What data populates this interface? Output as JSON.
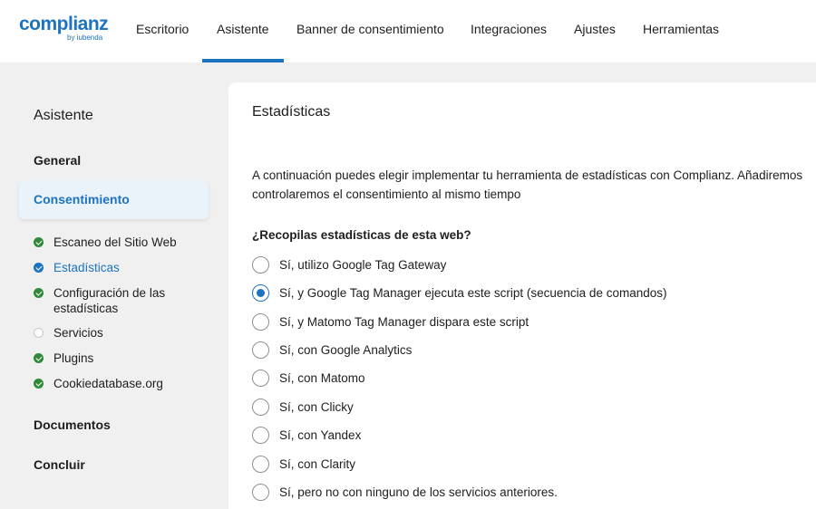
{
  "logo": {
    "name": "complianz",
    "sub": "by iubenda"
  },
  "nav": [
    {
      "label": "Escritorio",
      "active": false
    },
    {
      "label": "Asistente",
      "active": true
    },
    {
      "label": "Banner de consentimiento",
      "active": false
    },
    {
      "label": "Integraciones",
      "active": false
    },
    {
      "label": "Ajustes",
      "active": false
    },
    {
      "label": "Herramientas",
      "active": false
    }
  ],
  "sidebar": {
    "title": "Asistente",
    "sections": {
      "general": "General",
      "consent": "Consentimiento",
      "documents": "Documentos",
      "finish": "Concluir"
    },
    "steps": [
      {
        "label": "Escaneo del Sitio Web",
        "status": "done"
      },
      {
        "label": "Estadísticas",
        "status": "current"
      },
      {
        "label": "Configuración de las estadísticas",
        "status": "done"
      },
      {
        "label": "Servicios",
        "status": "empty"
      },
      {
        "label": "Plugins",
        "status": "done"
      },
      {
        "label": "Cookiedatabase.org",
        "status": "done"
      }
    ]
  },
  "main": {
    "title": "Estadísticas",
    "intro_line1": "A continuación puedes elegir implementar tu herramienta de estadísticas con Complianz. Añadiremos",
    "intro_line2": "controlaremos el consentimiento al mismo tiempo",
    "question": "¿Recopilas estadísticas de esta web?",
    "options": [
      {
        "label": "Sí, utilizo Google Tag Gateway",
        "checked": false
      },
      {
        "label": "Sí, y Google Tag Manager ejecuta este script (secuencia de comandos)",
        "checked": true
      },
      {
        "label": "Sí, y Matomo Tag Manager dispara este script",
        "checked": false
      },
      {
        "label": "Sí, con Google Analytics",
        "checked": false
      },
      {
        "label": "Sí, con Matomo",
        "checked": false
      },
      {
        "label": "Sí, con Clicky",
        "checked": false
      },
      {
        "label": "Sí, con Yandex",
        "checked": false
      },
      {
        "label": "Sí, con Clarity",
        "checked": false
      },
      {
        "label": "Sí, pero no con ninguno de los servicios anteriores.",
        "checked": false
      }
    ]
  },
  "colors": {
    "accent": "#1e73be",
    "done": "#2e8a37",
    "page_bg": "#f0f0f1",
    "active_bg": "#eaf2fa"
  }
}
